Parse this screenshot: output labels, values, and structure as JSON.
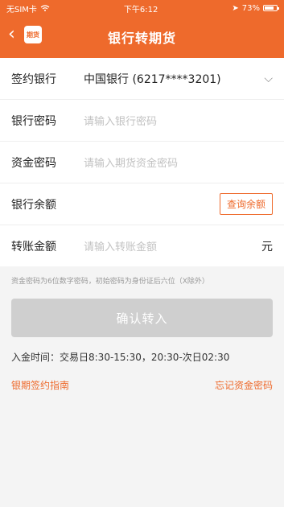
{
  "status_bar": {
    "carrier": "无SIM卡",
    "time": "下午6:12",
    "battery": "73%"
  },
  "header": {
    "back_icon": "chevron-left-icon",
    "logo_text": "期货",
    "title": "银行转期货"
  },
  "form": {
    "rows": [
      {
        "label": "签约银行",
        "value": "中国银行 (6217****3201)"
      },
      {
        "label": "银行密码",
        "placeholder": "请输入银行密码"
      },
      {
        "label": "资金密码",
        "placeholder": "请输入期货资金密码"
      },
      {
        "label": "银行余额",
        "button": "查询余额"
      },
      {
        "label": "转账金额",
        "placeholder": "请输入转账金额",
        "unit": "元"
      }
    ]
  },
  "hint": "资金密码为6位数字密码，初始密码为身份证后六位（X除外）",
  "confirm_label": "确认转入",
  "hours": "入金时间：交易日8:30-15:30，20:30-次日02:30",
  "links": {
    "guide": "银期签约指南",
    "forgot": "忘记资金密码"
  },
  "colors": {
    "accent": "#ee6a2c",
    "disabled": "#cfcfcf"
  }
}
